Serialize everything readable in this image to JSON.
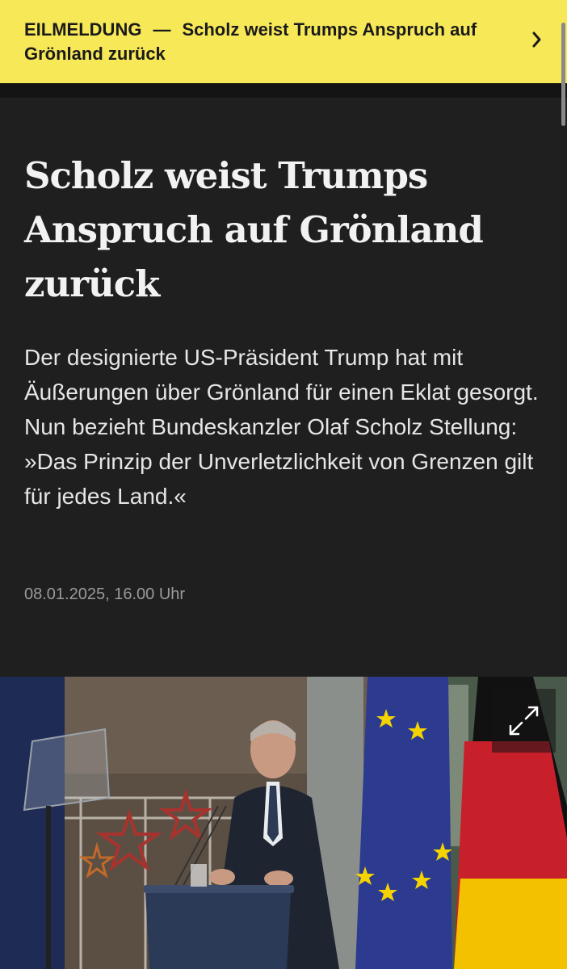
{
  "breaking_banner": {
    "label": "EILMELDUNG",
    "separator": "—",
    "headline": "Scholz weist Trumps Anspruch auf Grönland zurück",
    "background_color": "#f7e858",
    "icon": "chevron-right-icon"
  },
  "article": {
    "headline": "Scholz weist Trumps Anspruch auf Grönland zurück",
    "teaser": "Der designierte US-Präsident Trump hat mit Äußerungen über Grönland für einen Eklat gesorgt. Nun bezieht Bundeskanzler Olaf Scholz Stellung: »Das Prinzip der Unverletzlichkeit von Grenzen gilt für jedes Land.«",
    "date": "08.01.2025, 16.00 Uhr",
    "background_color": "#1f1f1f"
  },
  "photo": {
    "expand_icon": "expand-arrows-icon"
  }
}
